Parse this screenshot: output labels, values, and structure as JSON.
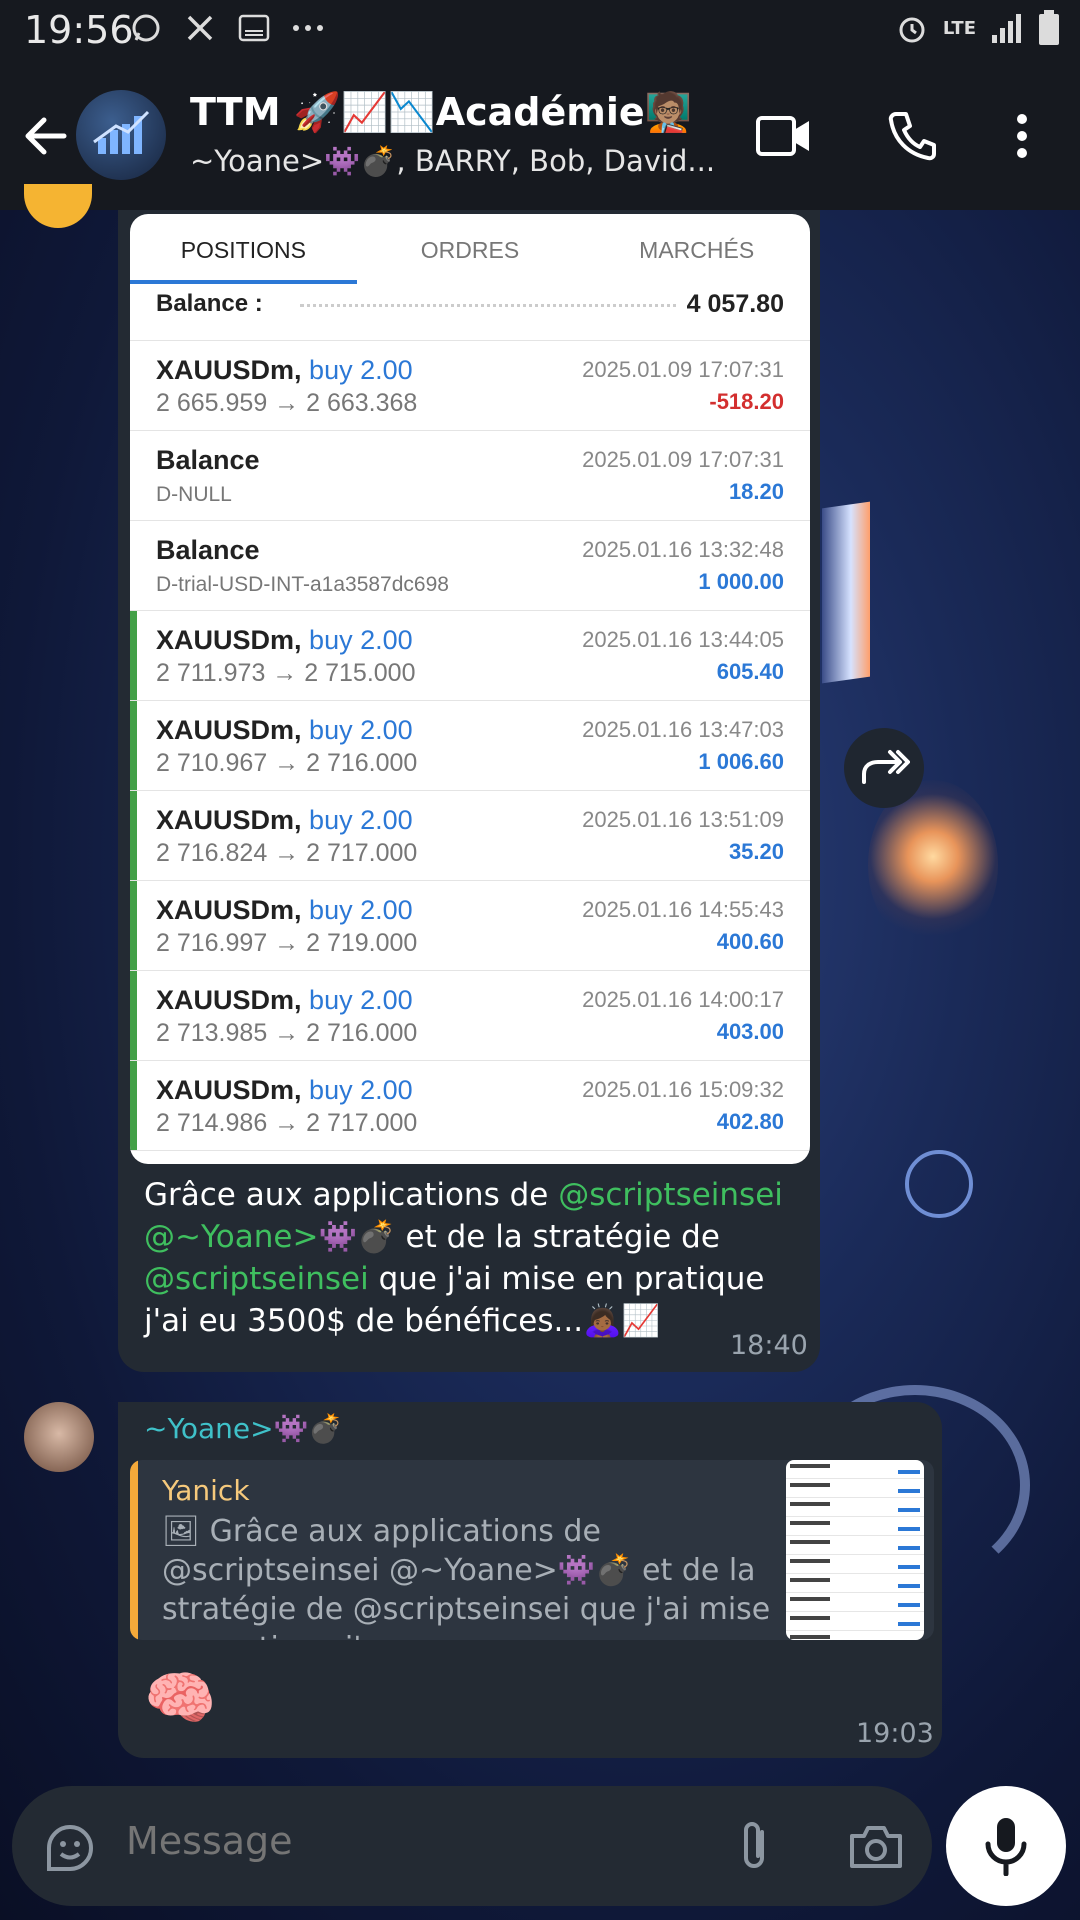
{
  "status_bar": {
    "time": "19:56",
    "network": "LTE",
    "icons": [
      "whatsapp-icon",
      "x-icon",
      "cassette-icon",
      "more-dots-icon",
      "alarm-icon",
      "signal-icon",
      "battery-icon"
    ]
  },
  "header": {
    "title": "TTM 🚀📈📉Académie🧑🏽‍🏫",
    "subtitle": "~Yoane>👾💣, BARRY, Bob, David..."
  },
  "message1": {
    "screenshot": {
      "tabs": [
        "POSITIONS",
        "ORDRES",
        "MARCHÉS"
      ],
      "active_tab": "POSITIONS",
      "balance_label": "Balance :",
      "balance_value": "4 057.80",
      "rows": [
        {
          "symbol": "XAUUSDm,",
          "side": "buy 2.00",
          "prices": "2 665.959 → 2 663.368",
          "date": "2025.01.09 17:07:31",
          "value": "-518.20",
          "highlight": false,
          "negative": true
        },
        {
          "symbol": "Balance",
          "side": "",
          "prices": "D-NULL",
          "date": "2025.01.09 17:07:31",
          "value": "18.20",
          "highlight": false,
          "negative": false
        },
        {
          "symbol": "Balance",
          "side": "",
          "prices": "D-trial-USD-INT-a1a3587dc698",
          "date": "2025.01.16 13:32:48",
          "value": "1 000.00",
          "highlight": false,
          "negative": false
        },
        {
          "symbol": "XAUUSDm,",
          "side": "buy 2.00",
          "prices": "2 711.973 → 2 715.000",
          "date": "2025.01.16 13:44:05",
          "value": "605.40",
          "highlight": true,
          "negative": false
        },
        {
          "symbol": "XAUUSDm,",
          "side": "buy 2.00",
          "prices": "2 710.967 → 2 716.000",
          "date": "2025.01.16 13:47:03",
          "value": "1 006.60",
          "highlight": true,
          "negative": false
        },
        {
          "symbol": "XAUUSDm,",
          "side": "buy 2.00",
          "prices": "2 716.824 → 2 717.000",
          "date": "2025.01.16 13:51:09",
          "value": "35.20",
          "highlight": true,
          "negative": false
        },
        {
          "symbol": "XAUUSDm,",
          "side": "buy 2.00",
          "prices": "2 716.997 → 2 719.000",
          "date": "2025.01.16 14:55:43",
          "value": "400.60",
          "highlight": true,
          "negative": false
        },
        {
          "symbol": "XAUUSDm,",
          "side": "buy 2.00",
          "prices": "2 713.985 → 2 716.000",
          "date": "2025.01.16 14:00:17",
          "value": "403.00",
          "highlight": true,
          "negative": false
        },
        {
          "symbol": "XAUUSDm,",
          "side": "buy 2.00",
          "prices": "2 714.986 → 2 717.000",
          "date": "2025.01.16 15:09:32",
          "value": "402.80",
          "highlight": true,
          "negative": false
        }
      ]
    },
    "caption_parts": {
      "p1": "Grâce aux applications de ",
      "m1": "@scriptseinsei",
      "m2": "@~Yoane>👾💣",
      "p2": " et de la stratégie de ",
      "m3": "@scriptseinsei",
      "p3": " que j'ai mise en pratique j'ai eu 3500$ de bénéfices...🙇🏾‍♀️📈"
    },
    "time": "18:40"
  },
  "message2": {
    "sender": "~Yoane>👾💣",
    "quote_author": "Yanick",
    "quote_text": "🖼 Grâce aux applications de @scriptseinsei @~Yoane>👾💣 et de la stratégie de @scriptseinsei que j'ai mise en pratique j'...",
    "body": "🧠",
    "time": "19:03"
  },
  "composer": {
    "placeholder": "Message"
  }
}
